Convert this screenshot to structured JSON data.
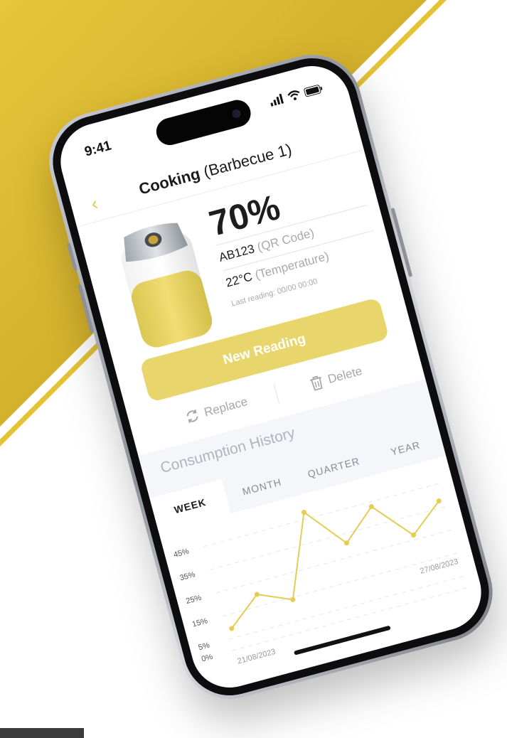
{
  "status_bar": {
    "time": "9:41"
  },
  "header": {
    "title_main": "Cooking",
    "title_sub": "(Barbecue 1)"
  },
  "tank": {
    "percent": "70%",
    "fill_fraction": 0.7
  },
  "info": {
    "code_value": "AB123",
    "code_label": "(QR Code)",
    "temp_value": "22°C",
    "temp_label": "(Temperature)",
    "last_reading": "Last reading: 00/00 00:00"
  },
  "actions": {
    "new_reading": "New Reading",
    "delete": "Delete",
    "replace": "Replace"
  },
  "history": {
    "title": "Consumption History",
    "tabs": [
      "WEEK",
      "MONTH",
      "QUARTER",
      "YEAR"
    ],
    "active_tab": "WEEK"
  },
  "chart_data": {
    "type": "line",
    "y_ticks": [
      "0%",
      "5%",
      "15%",
      "25%",
      "35%",
      "45%"
    ],
    "y_tick_values": [
      0,
      5,
      15,
      25,
      35,
      45
    ],
    "ylim": [
      0,
      48
    ],
    "x_start_label": "21/08/2023",
    "x_end_label": "27/08/2023",
    "values": [
      9,
      20,
      14,
      48,
      31,
      43,
      27,
      38
    ]
  },
  "colors": {
    "accent": "#e8d56b",
    "line": "#e3cd55",
    "gold_bg": "#dcb82c"
  }
}
